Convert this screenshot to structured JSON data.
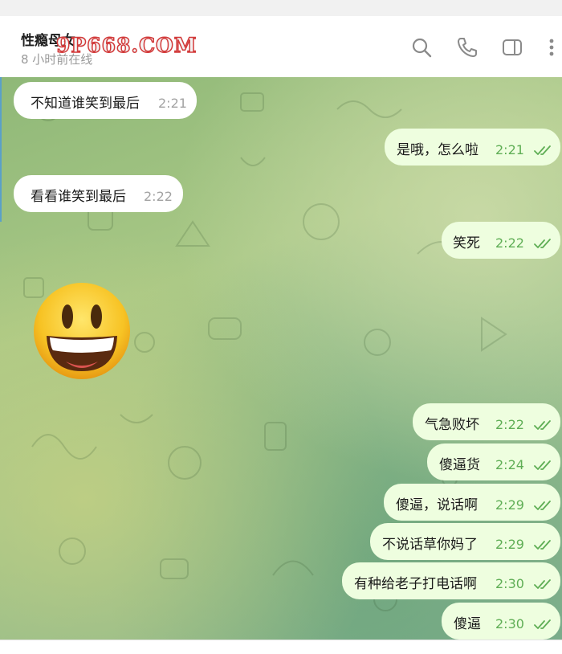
{
  "header": {
    "title": "性瘾母女",
    "status": "8 小时前在线",
    "watermark": "9P668.COM"
  },
  "icons": {
    "search": "search-icon",
    "call": "phone-icon",
    "sidebar": "sidebar-toggle-icon",
    "menu": "more-vertical-icon",
    "read": "double-check-icon"
  },
  "colors": {
    "outgoing_bubble": "#eefedf",
    "incoming_bubble": "#ffffff",
    "read_tick": "#5fae55"
  },
  "messages": [
    {
      "dir": "in",
      "text": "不知道谁笑到最后",
      "time": "2:21"
    },
    {
      "dir": "out",
      "text": "是哦，怎么啦",
      "time": "2:21"
    },
    {
      "dir": "in",
      "text": "看看谁笑到最后",
      "time": "2:22"
    },
    {
      "dir": "out",
      "text": "笑死",
      "time": "2:22"
    },
    {
      "dir": "in",
      "sticker": "grinning-face-emoji"
    },
    {
      "dir": "out",
      "text": "气急败坏",
      "time": "2:22"
    },
    {
      "dir": "out",
      "text": "傻逼货",
      "time": "2:24"
    },
    {
      "dir": "out",
      "text": "傻逼，说话啊",
      "time": "2:29"
    },
    {
      "dir": "out",
      "text": "不说话草你妈了",
      "time": "2:29"
    },
    {
      "dir": "out",
      "text": "有种给老子打电话啊",
      "time": "2:30"
    },
    {
      "dir": "out",
      "text": "傻逼",
      "time": "2:30"
    }
  ]
}
